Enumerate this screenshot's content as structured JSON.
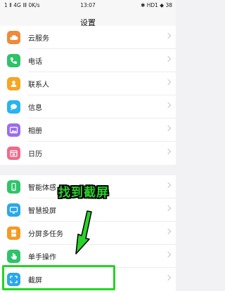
{
  "status_bar": {
    "left": "1 Ⅱ 4G ⅠⅡ 0K/s",
    "time": "13:07",
    "right": "✱ HD1 ◆ 38"
  },
  "header": {
    "title": "设置"
  },
  "group1": [
    {
      "label": "云服务",
      "icon": "cloud-icon",
      "color": "#f08a3a"
    },
    {
      "label": "电话",
      "icon": "phone-icon",
      "color": "#2dc36a"
    },
    {
      "label": "联系人",
      "icon": "contacts-icon",
      "color": "#f5a623"
    },
    {
      "label": "信息",
      "icon": "message-icon",
      "color": "#2bb3f0"
    },
    {
      "label": "相册",
      "icon": "gallery-icon",
      "color": "#9b6cf0"
    },
    {
      "label": "日历",
      "icon": "calendar-icon",
      "color": "#f06a8a"
    }
  ],
  "group2": [
    {
      "label": "智能体感",
      "icon": "motion-icon",
      "color": "#2ec46a"
    },
    {
      "label": "智慧投屏",
      "icon": "screencast-icon",
      "color": "#2aa8e8"
    },
    {
      "label": "分屏多任务",
      "icon": "split-screen-icon",
      "color": "#f59a23"
    },
    {
      "label": "单手操作",
      "icon": "one-hand-icon",
      "color": "#2ec46a"
    },
    {
      "label": "截屏",
      "icon": "screenshot-icon",
      "color": "#2aa8e8"
    }
  ],
  "annotation": {
    "text": "找到截屏",
    "color": "#2ad22a"
  }
}
